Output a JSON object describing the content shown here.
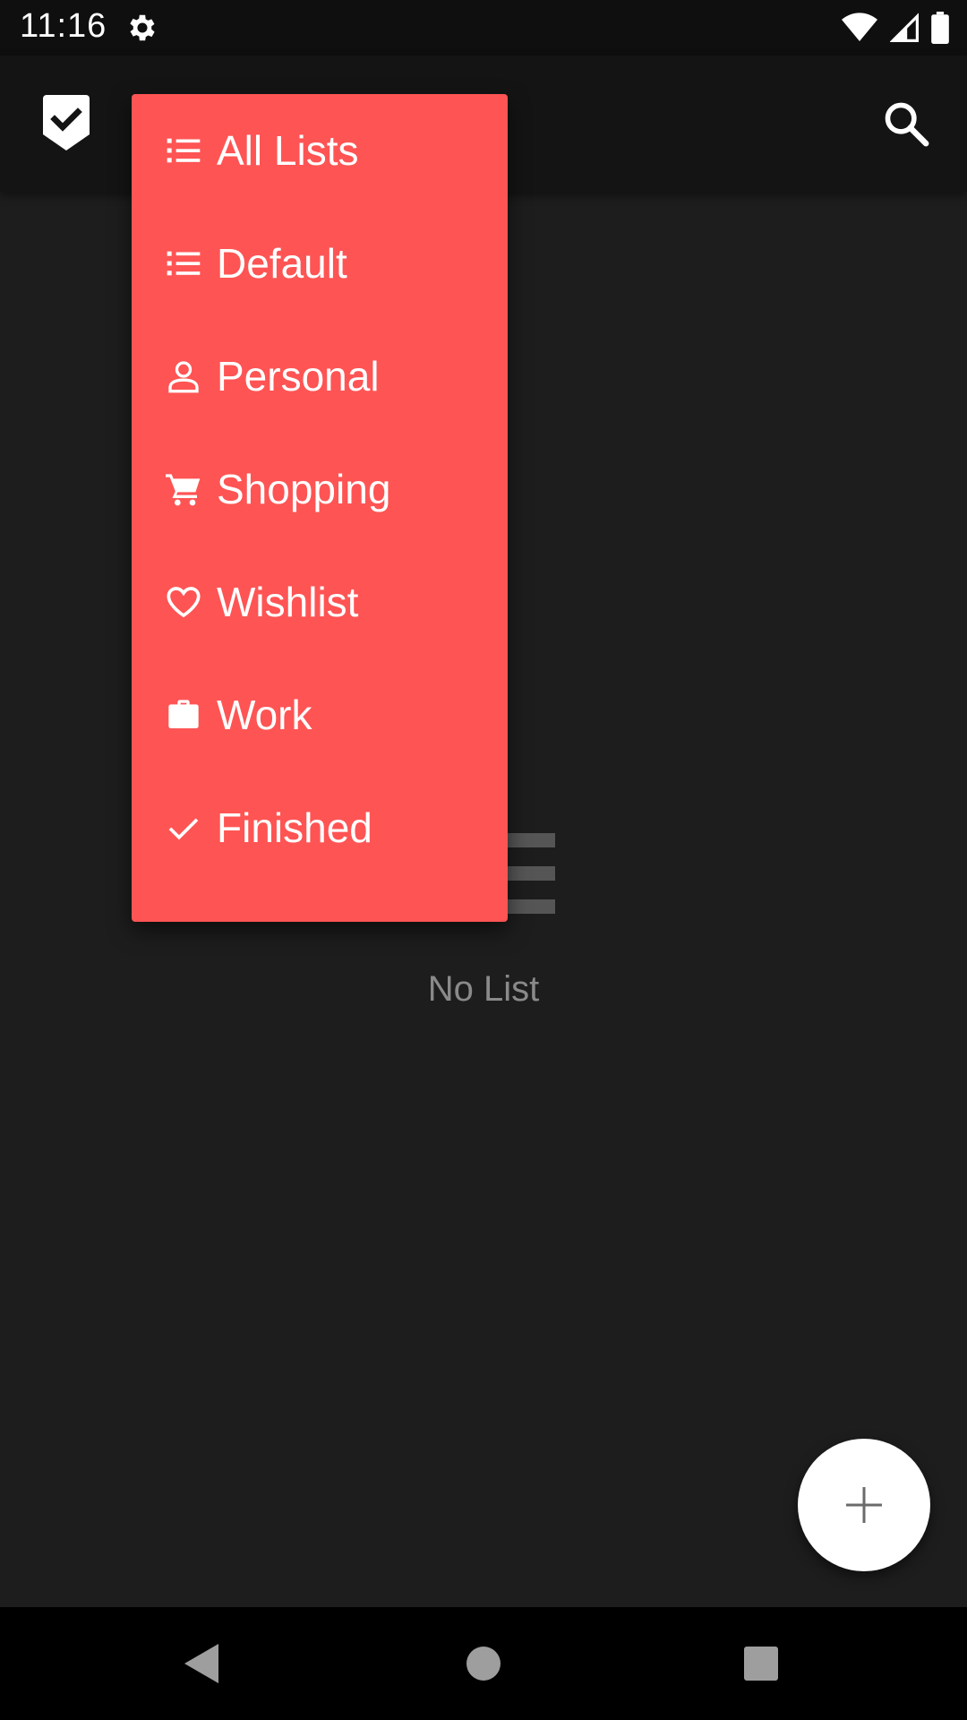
{
  "status_bar": {
    "time": "11:16",
    "icons": [
      "gear-icon",
      "wifi-icon",
      "signal-icon",
      "battery-icon"
    ]
  },
  "app_bar": {
    "logo_icon": "shield-check-icon",
    "search_icon": "search-icon"
  },
  "menu": {
    "background": "#ff5454",
    "items": [
      {
        "label": "All Lists",
        "icon": "list-icon"
      },
      {
        "label": "Default",
        "icon": "list-icon"
      },
      {
        "label": "Personal",
        "icon": "person-icon"
      },
      {
        "label": "Shopping",
        "icon": "cart-icon"
      },
      {
        "label": "Wishlist",
        "icon": "heart-icon"
      },
      {
        "label": "Work",
        "icon": "briefcase-icon"
      },
      {
        "label": "Finished",
        "icon": "check-icon"
      }
    ]
  },
  "empty_state": {
    "icon": "list-placeholder-icon",
    "text": "No List"
  },
  "fab": {
    "icon": "plus-icon"
  },
  "nav_bar": {
    "icons": [
      "back-icon",
      "home-icon",
      "recents-icon"
    ]
  }
}
